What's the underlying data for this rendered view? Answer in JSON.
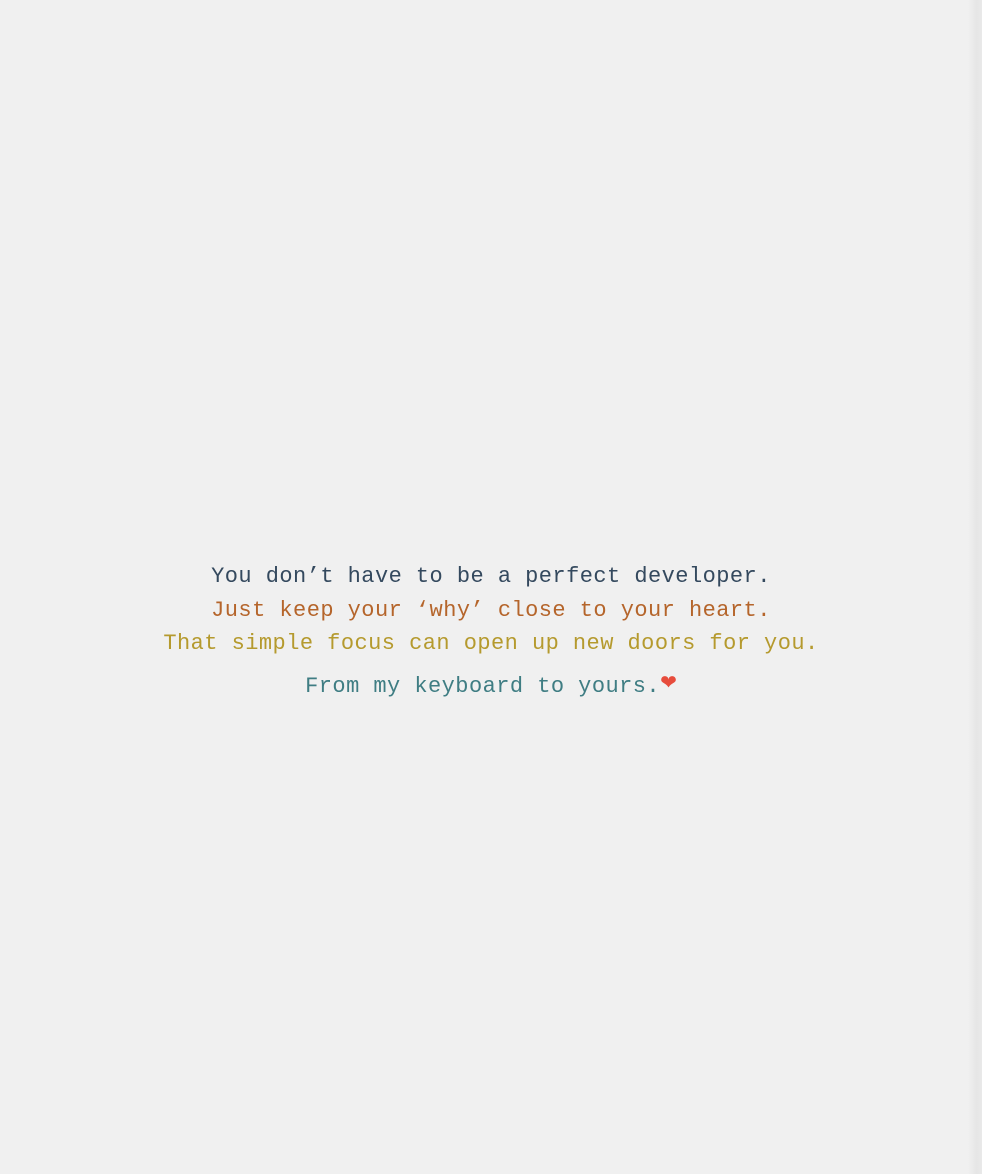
{
  "message": {
    "line_1": "You don’t have to be a perfect developer.",
    "line_2": "Just keep your ‘why’ close to your heart.",
    "line_3": "That simple focus can open up new doors for you."
  },
  "signature": {
    "text": "From my keyboard to yours.",
    "heart_icon": "❤"
  },
  "colors": {
    "background": "#f0f0f0",
    "line_1": "#34495e",
    "line_2": "#b5652b",
    "line_3": "#b59a2e",
    "signature": "#3f7d83",
    "heart": "#e74c3c"
  }
}
